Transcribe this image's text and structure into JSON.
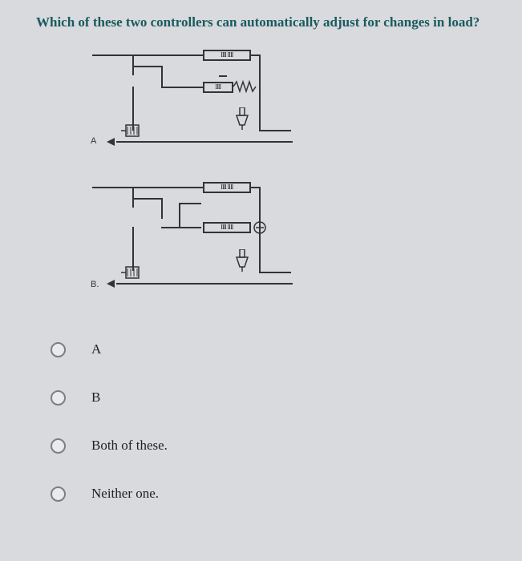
{
  "question": "Which of these two controllers can automatically adjust for changes in load?",
  "diagram": {
    "label_a": "A",
    "label_b": "B.",
    "coil_text": "0000 0000"
  },
  "options": [
    {
      "label": "A"
    },
    {
      "label": "B"
    },
    {
      "label": "Both of these."
    },
    {
      "label": "Neither one."
    }
  ]
}
